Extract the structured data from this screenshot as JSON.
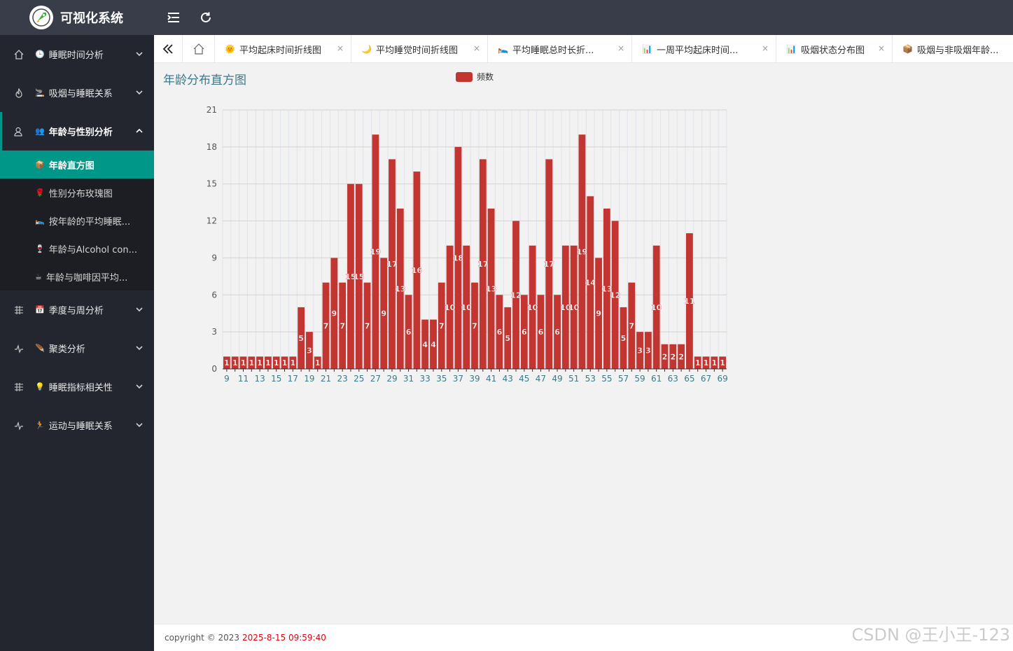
{
  "app": {
    "title": "可视化系统",
    "menu_toggle_icon": "menu-fold-icon",
    "refresh_icon": "refresh-icon"
  },
  "sidebar": {
    "items": [
      {
        "label": "睡眠时间分析",
        "emoji": "🕒",
        "icon": "home-icon"
      },
      {
        "label": "吸烟与睡眠关系",
        "emoji": "🚬",
        "icon": "fire-icon"
      },
      {
        "label": "年龄与性别分析",
        "emoji": "👥",
        "icon": "user-icon"
      },
      {
        "label": "季度与周分析",
        "emoji": "📅",
        "icon": "grid-icon"
      },
      {
        "label": "聚类分析",
        "emoji": "🪶",
        "icon": "pulse-icon"
      },
      {
        "label": "睡眠指标相关性",
        "emoji": "💡",
        "icon": "grid-icon"
      },
      {
        "label": "运动与睡眠关系",
        "emoji": "🏃",
        "icon": "pulse-icon"
      }
    ],
    "subitems": [
      {
        "label": "年龄直方图",
        "emoji": "📦"
      },
      {
        "label": "性别分布玫瑰图",
        "emoji": "🌹"
      },
      {
        "label": "按年龄的平均睡眠...",
        "emoji": "🛌"
      },
      {
        "label": "年龄与Alcohol con...",
        "emoji": "🍷"
      },
      {
        "label": "年龄与咖啡因平均...",
        "emoji": "☕"
      }
    ]
  },
  "tabs": {
    "collapse_icon": "double-chevron-left-icon",
    "home_icon": "home-icon",
    "items": [
      {
        "label": "平均起床时间折线图",
        "emoji": "🌞"
      },
      {
        "label": "平均睡觉时间折线图",
        "emoji": "🌙"
      },
      {
        "label": "平均睡眠总时长折...",
        "emoji": "🛌"
      },
      {
        "label": "一周平均起床时间...",
        "emoji": "📊"
      },
      {
        "label": "吸烟状态分布图",
        "emoji": "📊"
      },
      {
        "label": "吸烟与非吸烟年龄...",
        "emoji": "📦"
      }
    ],
    "close_glyph": "×"
  },
  "chart_title": "年龄分布直方图",
  "chart_data": {
    "type": "bar",
    "title": "年龄分布直方图",
    "legend": [
      "频数"
    ],
    "legend_position": "top-center",
    "series_color": "#c23531",
    "x": [
      9,
      10,
      11,
      12,
      13,
      14,
      15,
      16,
      17,
      18,
      19,
      20,
      21,
      22,
      23,
      24,
      25,
      26,
      27,
      28,
      29,
      30,
      31,
      32,
      33,
      34,
      35,
      36,
      37,
      38,
      39,
      40,
      41,
      42,
      43,
      44,
      45,
      46,
      47,
      48,
      49,
      50,
      51,
      52,
      53,
      54,
      55,
      56,
      57,
      58,
      59,
      60,
      61,
      62,
      63,
      64,
      65,
      66,
      67,
      68,
      69
    ],
    "values": [
      1,
      1,
      1,
      1,
      1,
      1,
      1,
      1,
      1,
      5,
      3,
      1,
      7,
      9,
      7,
      15,
      15,
      7,
      19,
      9,
      17,
      13,
      6,
      16,
      4,
      4,
      7,
      10,
      18,
      10,
      7,
      17,
      13,
      6,
      5,
      12,
      6,
      10,
      6,
      17,
      6,
      10,
      10,
      19,
      14,
      9,
      13,
      12,
      5,
      7,
      3,
      3,
      10,
      2,
      2,
      2,
      11,
      1,
      1,
      1,
      1
    ],
    "x_tick_labels": [
      "9",
      "11",
      "13",
      "15",
      "17",
      "19",
      "21",
      "23",
      "25",
      "27",
      "29",
      "31",
      "33",
      "35",
      "37",
      "39",
      "41",
      "43",
      "45",
      "47",
      "49",
      "51",
      "53",
      "55",
      "57",
      "59",
      "61",
      "63",
      "65",
      "67",
      "69"
    ],
    "y_ticks": [
      0,
      3,
      6,
      9,
      12,
      15,
      18,
      21
    ],
    "ylim": [
      0,
      21
    ],
    "grid": true
  },
  "footer": {
    "copyright": "copyright © 2023",
    "time": "2025-8-15 09:59:40"
  },
  "watermark": "CSDN @王小王-123"
}
